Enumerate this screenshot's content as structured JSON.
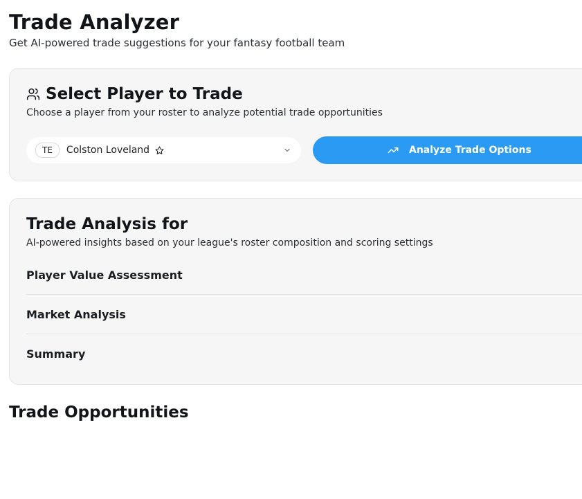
{
  "header": {
    "title": "Trade Analyzer",
    "subtitle": "Get AI-powered trade suggestions for your fantasy football team"
  },
  "select_card": {
    "icon": "users-icon",
    "title": "Select Player to Trade",
    "description": "Choose a player from your roster to analyze potential trade opportunities",
    "player_select": {
      "position": "TE",
      "name": "Colston Loveland",
      "favorite_icon": "star-outline-icon",
      "dropdown_icon": "chevron-down-icon"
    },
    "analyze_button": {
      "label": "Analyze Trade Options",
      "icon": "trending-up-icon"
    }
  },
  "analysis_card": {
    "title": "Trade Analysis for",
    "description": "AI-powered insights based on your league's roster composition and scoring settings",
    "sections": [
      {
        "label": "Player Value Assessment"
      },
      {
        "label": "Market Analysis"
      },
      {
        "label": "Summary"
      }
    ]
  },
  "opportunities": {
    "title": "Trade Opportunities"
  },
  "colors": {
    "accent": "#2b9af3",
    "card_bg": "#f5f6f5",
    "card_border": "#e2e5e3",
    "text": "#111418"
  }
}
